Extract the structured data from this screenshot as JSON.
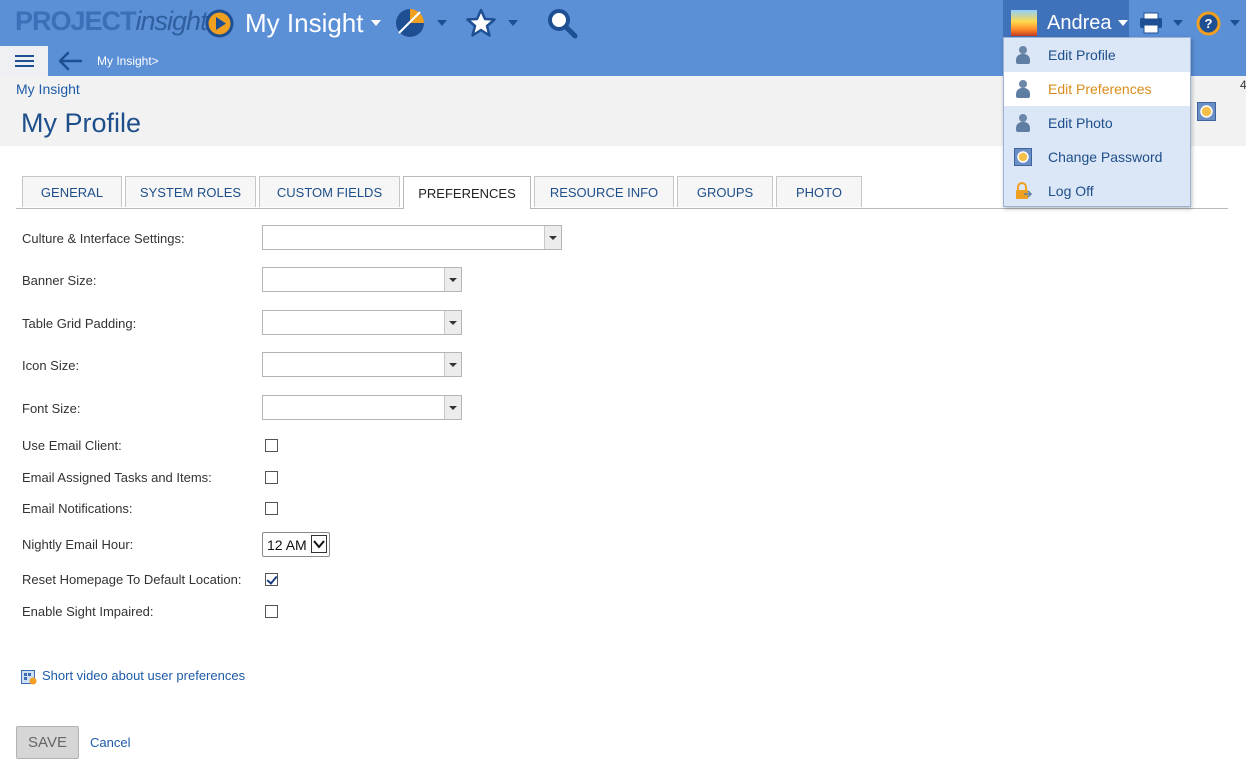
{
  "header": {
    "logo_main": "PROJECT",
    "logo_sub": "insight",
    "nav_title": "My Insight",
    "user_name": "Andrea"
  },
  "subbar": {
    "breadcrumb": "My Insight>"
  },
  "page": {
    "breadcrumb_link": "My Insight",
    "title": "My Profile"
  },
  "tabs": [
    "GENERAL",
    "SYSTEM ROLES",
    "CUSTOM FIELDS",
    "PREFERENCES",
    "RESOURCE INFO",
    "GROUPS",
    "PHOTO"
  ],
  "form": {
    "culture_label": "Culture & Interface Settings:",
    "banner_label": "Banner Size:",
    "padding_label": "Table Grid Padding:",
    "icon_label": "Icon Size:",
    "font_label": "Font Size:",
    "email_client_label": "Use Email Client:",
    "email_tasks_label": "Email Assigned Tasks and Items:",
    "email_notif_label": "Email Notifications:",
    "nightly_label": "Nightly Email Hour:",
    "nightly_value": "12 AM",
    "reset_home_label": "Reset Homepage To Default Location:",
    "sight_label": "Enable Sight Impaired:",
    "video_link": "Short video about user preferences",
    "save_label": "SAVE",
    "cancel_label": "Cancel"
  },
  "user_menu": [
    "Edit Profile",
    "Edit Preferences",
    "Edit Photo",
    "Change Password",
    "Log Off"
  ],
  "edge_glyph": "4",
  "colors": {
    "topbar": "#5b8fd6",
    "link": "#1e5ba8",
    "highlight": "#d98c1a"
  }
}
